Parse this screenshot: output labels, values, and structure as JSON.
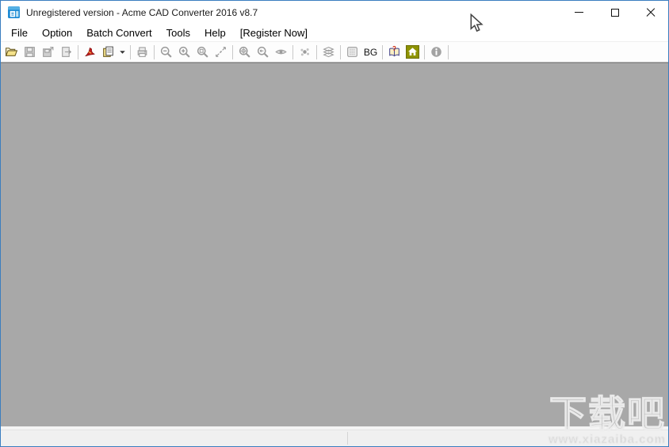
{
  "window": {
    "title": "Unregistered version - Acme CAD Converter 2016 v8.7",
    "controls": [
      {
        "id": "minimize",
        "name": "minimize-button"
      },
      {
        "id": "maximize",
        "name": "maximize-button"
      },
      {
        "id": "close",
        "name": "close-button"
      }
    ]
  },
  "menu": {
    "items": [
      {
        "id": "file",
        "label": "File"
      },
      {
        "id": "option",
        "label": "Option"
      },
      {
        "id": "batch-convert",
        "label": "Batch Convert"
      },
      {
        "id": "tools",
        "label": "Tools"
      },
      {
        "id": "help",
        "label": "Help"
      },
      {
        "id": "register-now",
        "label": "[Register Now]"
      }
    ]
  },
  "toolbar": {
    "items": [
      {
        "type": "button",
        "icon": "open-file-icon",
        "enabled": true
      },
      {
        "type": "button",
        "icon": "save-icon",
        "enabled": false
      },
      {
        "type": "button",
        "icon": "save-as-icon",
        "enabled": false
      },
      {
        "type": "button",
        "icon": "export-icon",
        "enabled": false
      },
      {
        "type": "separator"
      },
      {
        "type": "button",
        "icon": "pdf-convert-icon",
        "enabled": true
      },
      {
        "type": "button",
        "icon": "batch-convert-icon",
        "enabled": true
      },
      {
        "type": "button",
        "icon": "dropdown-arrow-icon",
        "enabled": true
      },
      {
        "type": "separator"
      },
      {
        "type": "button",
        "icon": "print-icon",
        "enabled": false
      },
      {
        "type": "separator"
      },
      {
        "type": "button",
        "icon": "zoom-out-icon",
        "enabled": false
      },
      {
        "type": "button",
        "icon": "zoom-in-icon",
        "enabled": false
      },
      {
        "type": "button",
        "icon": "zoom-window-icon",
        "enabled": false
      },
      {
        "type": "button",
        "icon": "zoom-extents-icon",
        "enabled": false
      },
      {
        "type": "separator"
      },
      {
        "type": "button",
        "icon": "zoom-all-icon",
        "enabled": false
      },
      {
        "type": "button",
        "icon": "zoom-previous-icon",
        "enabled": false
      },
      {
        "type": "button",
        "icon": "eye-icon",
        "enabled": false
      },
      {
        "type": "separator"
      },
      {
        "type": "button",
        "icon": "plot-icon",
        "enabled": false
      },
      {
        "type": "separator"
      },
      {
        "type": "button",
        "icon": "layers-icon",
        "enabled": false
      },
      {
        "type": "separator"
      },
      {
        "type": "button",
        "icon": "raster-icon",
        "enabled": false
      },
      {
        "type": "button",
        "icon": "bg-icon",
        "label": "BG",
        "enabled": true
      },
      {
        "type": "separator"
      },
      {
        "type": "button",
        "icon": "help-book-icon",
        "enabled": true
      },
      {
        "type": "button",
        "icon": "home-icon",
        "enabled": true
      },
      {
        "type": "separator"
      },
      {
        "type": "button",
        "icon": "info-icon",
        "enabled": true
      },
      {
        "type": "separator"
      }
    ]
  },
  "statusbar": {
    "left_text": "",
    "right_text": ""
  },
  "watermark": {
    "brand": "下载吧",
    "url": "www.xiazaiba.com"
  },
  "colors": {
    "window_border": "#3a7ebf",
    "canvas_bg": "#a8a8a8",
    "statusbar_bg": "#f0f0f0",
    "home_icon_bg": "#8e9301",
    "pdf_icon_red": "#bf1d1d",
    "open_folder_yellow": "#f5e28a"
  }
}
